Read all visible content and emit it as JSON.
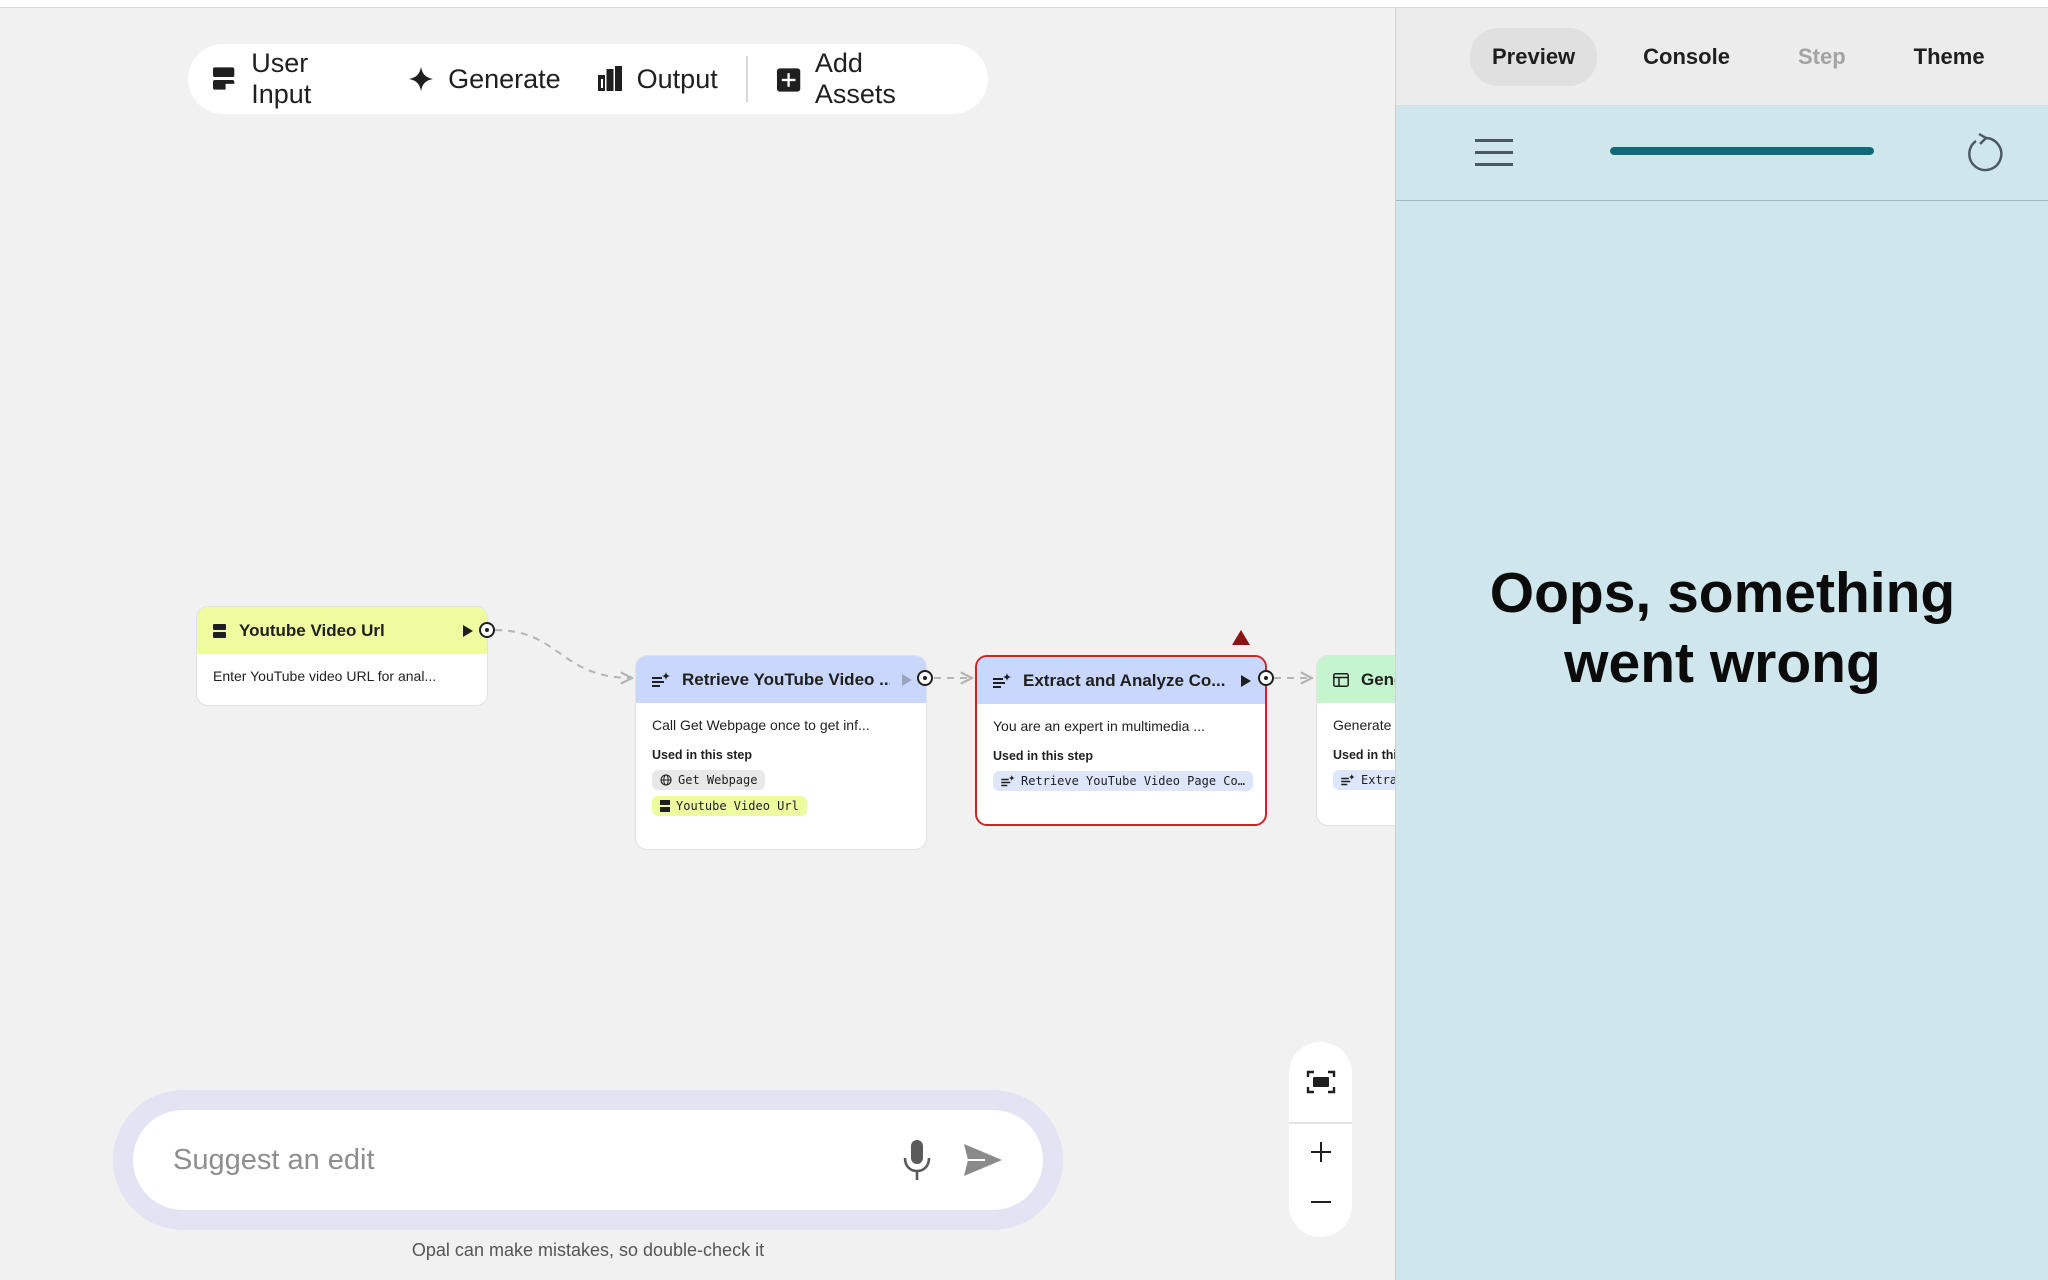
{
  "toolbar": {
    "user_input_label": "User Input",
    "generate_label": "Generate",
    "output_label": "Output",
    "add_assets_label": "Add Assets"
  },
  "nodes": [
    {
      "title": "Youtube Video Url",
      "description": "Enter YouTube video URL for anal...",
      "color": "#eefc9f"
    },
    {
      "title": "Retrieve YouTube Video ...",
      "description": "Call Get Webpage once to get inf...",
      "used_label": "Used in this step",
      "chips": [
        "Get Webpage",
        "Youtube Video Url"
      ],
      "color": "#c8d7fb"
    },
    {
      "title": "Extract and Analyze Co...",
      "description": "You are an expert in multimedia ...",
      "used_label": "Used in this step",
      "chips": [
        "Retrieve YouTube Video Page Co…"
      ],
      "color": "#c8d7fb",
      "status": "error"
    },
    {
      "title": "Gene",
      "description": "Generate",
      "used_label": "Used in thi",
      "chips": [
        "Extra"
      ],
      "color": "#c4f5cf"
    }
  ],
  "chat": {
    "placeholder": "Suggest an edit",
    "disclaimer": "Opal can make mistakes, so double-check it"
  },
  "panel": {
    "tabs": [
      {
        "label": "Preview",
        "state": "active"
      },
      {
        "label": "Console",
        "state": "normal"
      },
      {
        "label": "Step",
        "state": "disabled"
      },
      {
        "label": "Theme",
        "state": "normal"
      }
    ],
    "progress": 1.0,
    "message": "Oops, something went wrong"
  },
  "colors": {
    "canvas": "#f1f1f1",
    "panel": "#cfe6ec",
    "progress": "#0f6a78",
    "error_border": "#c62828"
  }
}
